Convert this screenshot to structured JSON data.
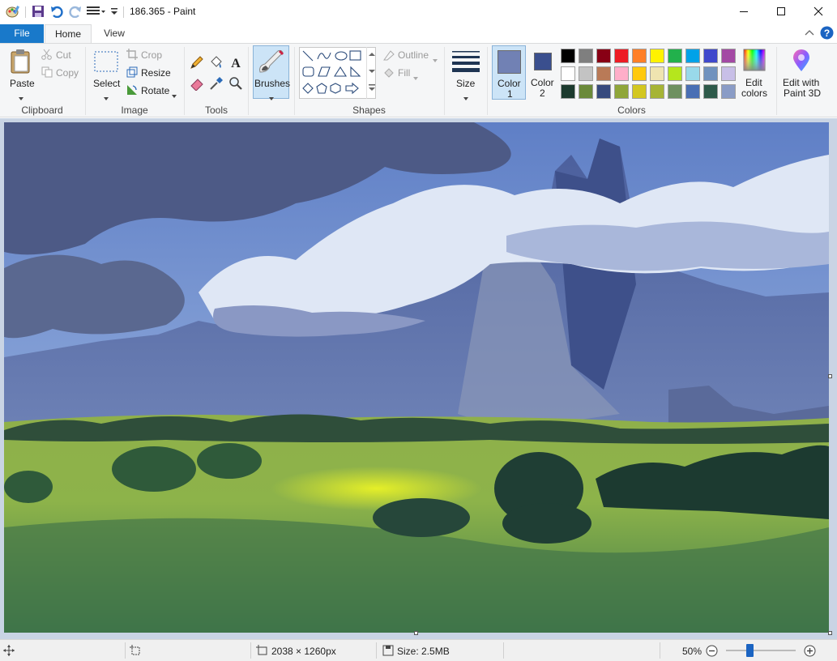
{
  "window": {
    "title": "186.365 - Paint"
  },
  "tabs": {
    "file": "File",
    "home": "Home",
    "view": "View"
  },
  "ribbon": {
    "clipboard": {
      "paste": "Paste",
      "cut": "Cut",
      "copy": "Copy",
      "label": "Clipboard"
    },
    "image": {
      "select": "Select",
      "crop": "Crop",
      "resize": "Resize",
      "rotate": "Rotate",
      "label": "Image"
    },
    "tools": {
      "label": "Tools"
    },
    "brushes": {
      "label": "Brushes"
    },
    "shapes": {
      "outline": "Outline",
      "fill": "Fill",
      "label": "Shapes"
    },
    "size": {
      "label": "Size"
    },
    "colors": {
      "color1": "Color\n1",
      "color1_line1": "Color",
      "color1_line2": "1",
      "color2_line1": "Color",
      "color2_line2": "2",
      "edit_colors_line1": "Edit",
      "edit_colors_line2": "colors",
      "label": "Colors",
      "color1_value": "#7181b4",
      "color2_value": "#3a4f8e",
      "palette_row1": [
        "#000000",
        "#7f7f7f",
        "#880015",
        "#ed1c24",
        "#ff7f27",
        "#fff200",
        "#22b14c",
        "#00a2e8",
        "#3f48cc",
        "#a349a4"
      ],
      "palette_row2": [
        "#ffffff",
        "#c3c3c3",
        "#b97a57",
        "#ffaec9",
        "#ffc90e",
        "#efe4b0",
        "#b5e61d",
        "#99d9ea",
        "#7092be",
        "#c8bfe7"
      ],
      "palette_row3": [
        "#1c3a2e",
        "#6b8a3a",
        "#364a7e",
        "#8fa63a",
        "#d3c720",
        "#a6b436",
        "#6e9060",
        "#4a6fb4",
        "#2e5a4a",
        "#8a9cc6"
      ]
    },
    "paint3d": {
      "line1": "Edit with",
      "line2": "Paint 3D"
    }
  },
  "status": {
    "dimensions": "2038 × 1260px",
    "size": "Size: 2.5MB",
    "zoom": "50%",
    "zoom_level": 0.5
  }
}
